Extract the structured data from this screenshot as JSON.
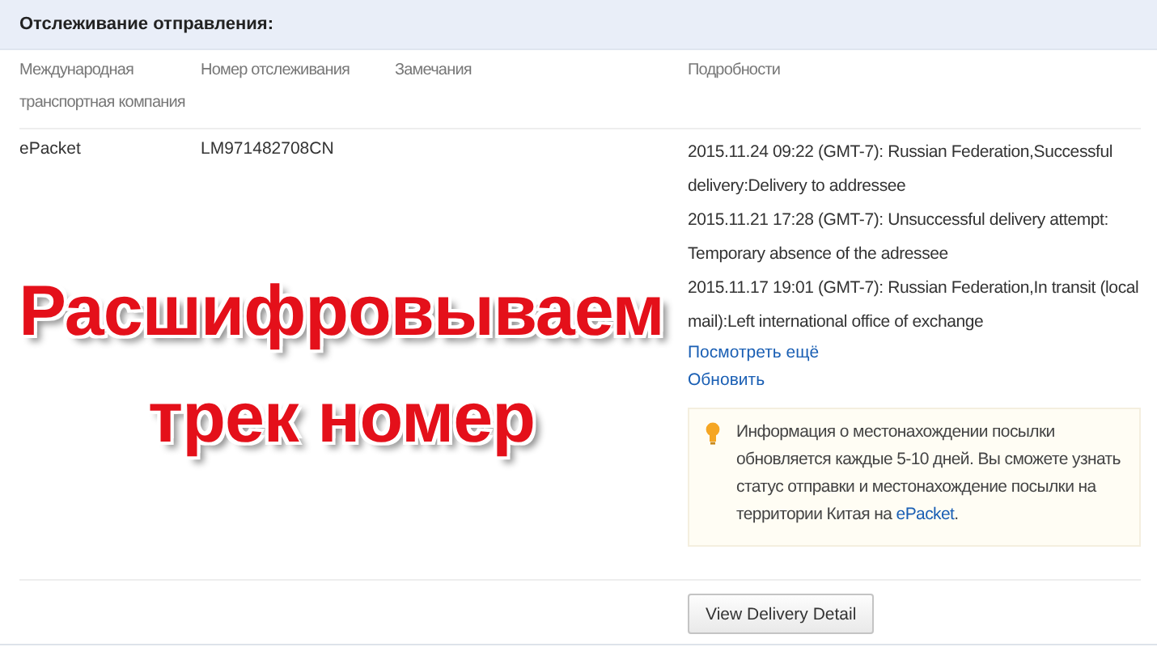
{
  "panel": {
    "title": "Отслеживание отправления:"
  },
  "columns": [
    "Международная транспортная компания",
    "Номер отслеживания",
    "Замечания",
    "Подробности"
  ],
  "rows": [
    {
      "carrier": "ePacket",
      "tracking_number": "LM971482708CN",
      "events": [
        "2015.11.24 09:22 (GMT-7): Russian Federation,Successful delivery:Delivery to addressee",
        "2015.11.21 17:28 (GMT-7): Unsuccessful delivery attempt: Temporary absence of the adressee",
        "2015.11.17 19:01 (GMT-7): Russian Federation,In transit (local mail):Left international office of exchange"
      ],
      "links": [
        "Посмотреть ещё",
        "Обновить"
      ],
      "notice": {
        "text": "Информация о местонахождении посылки обновляется каждые 5-10 дней. Вы сможете узнать статус отправки и местонахождение посылки на территории Китая на",
        "link": "ePacket",
        "end": "."
      }
    }
  ],
  "button": "View Delivery Detail",
  "overlay": {
    "lines": [
      "Расшифровываем",
      "трек номер"
    ]
  }
}
